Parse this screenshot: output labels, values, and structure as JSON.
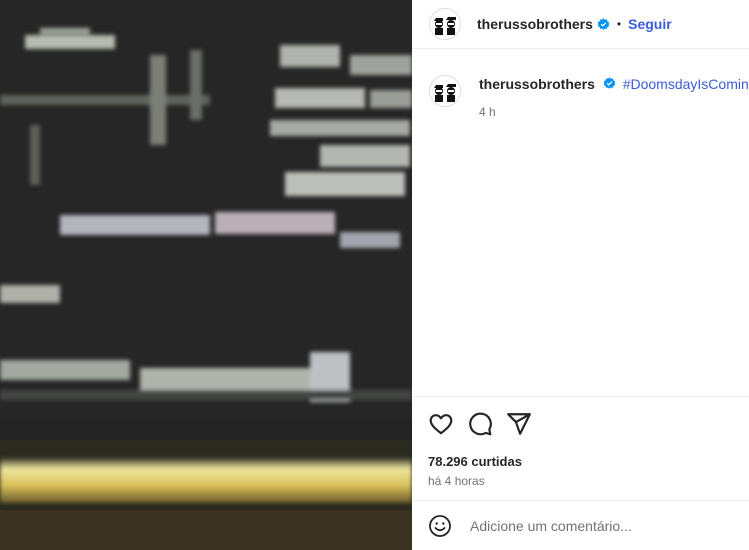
{
  "post": {
    "author": "therussobrothers",
    "follow_label": "Seguir",
    "separator": "•",
    "caption_hashtag": "#DoomsdayIsComing",
    "caption_time": "4 h",
    "likes": "78.296 curtidas",
    "posted_ago": "há 4 horas",
    "comment_placeholder": "Adicione um comentário..."
  },
  "icons": {
    "verified": "verified-badge-icon",
    "like": "heart-icon",
    "comment": "comment-icon",
    "share": "paper-plane-icon",
    "emoji": "emoji-icon"
  },
  "colors": {
    "verified": "#0095f6",
    "link": "#3b5bdb",
    "media_bg": "#232323",
    "text": "#262626",
    "muted": "#737373"
  }
}
